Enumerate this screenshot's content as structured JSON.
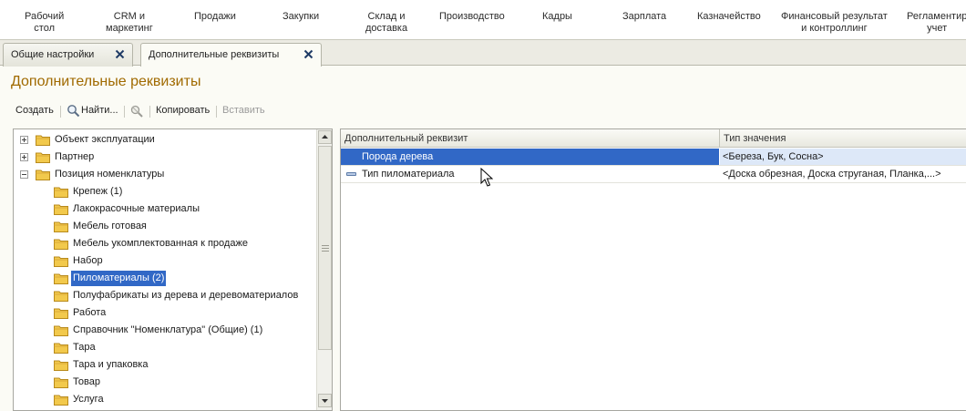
{
  "sections": [
    {
      "label": "Рабочий\nстол"
    },
    {
      "label": "CRM и\nмаркетинг"
    },
    {
      "label": "Продажи"
    },
    {
      "label": "Закупки"
    },
    {
      "label": "Склад и\nдоставка"
    },
    {
      "label": "Производство"
    },
    {
      "label": "Кадры"
    },
    {
      "label": "Зарплата"
    },
    {
      "label": "Казначейство"
    },
    {
      "label": "Финансовый результат\nи контроллинг"
    },
    {
      "label": "Регламентир\nучет"
    }
  ],
  "tabs": [
    {
      "label": "Общие настройки",
      "close_icon": "close-icon"
    },
    {
      "label": "Дополнительные реквизиты",
      "close_icon": "close-icon"
    }
  ],
  "page_title": "Дополнительные реквизиты",
  "commands": {
    "create": "Создать",
    "find": "Найти...",
    "copy": "Копировать",
    "paste": "Вставить"
  },
  "tree": [
    {
      "label": "Объект эксплуатации",
      "expander": "plus",
      "level": 0
    },
    {
      "label": "Партнер",
      "expander": "plus",
      "level": 0
    },
    {
      "label": "Позиция номенклатуры",
      "expander": "minus",
      "level": 0
    },
    {
      "label": "Крепеж (1)",
      "level": 1
    },
    {
      "label": "Лакокрасочные материалы",
      "level": 1
    },
    {
      "label": "Мебель готовая",
      "level": 1
    },
    {
      "label": "Мебель укомплектованная к продаже",
      "level": 1
    },
    {
      "label": "Набор",
      "level": 1
    },
    {
      "label": "Пиломатериалы (2)",
      "level": 1,
      "selected": true
    },
    {
      "label": "Полуфабрикаты из дерева и деревоматериалов",
      "level": 1
    },
    {
      "label": "Работа",
      "level": 1
    },
    {
      "label": "Справочник \"Номенклатура\" (Общие) (1)",
      "level": 1
    },
    {
      "label": "Тара",
      "level": 1
    },
    {
      "label": "Тара и упаковка",
      "level": 1
    },
    {
      "label": "Товар",
      "level": 1
    },
    {
      "label": "Услуга",
      "level": 1
    }
  ],
  "grid": {
    "columns": [
      "Дополнительный реквизит",
      "Тип значения"
    ],
    "rows": [
      {
        "name": "Порода дерева",
        "type": "<Береза, Бук, Сосна>",
        "selected": true
      },
      {
        "name": "Тип пиломатериала",
        "type": "<Доска обрезная, Доска струганая, Планка,...>"
      }
    ]
  },
  "colors": {
    "title": "#a06a00",
    "selection": "#3168c6",
    "folder": "#f2c94c"
  }
}
